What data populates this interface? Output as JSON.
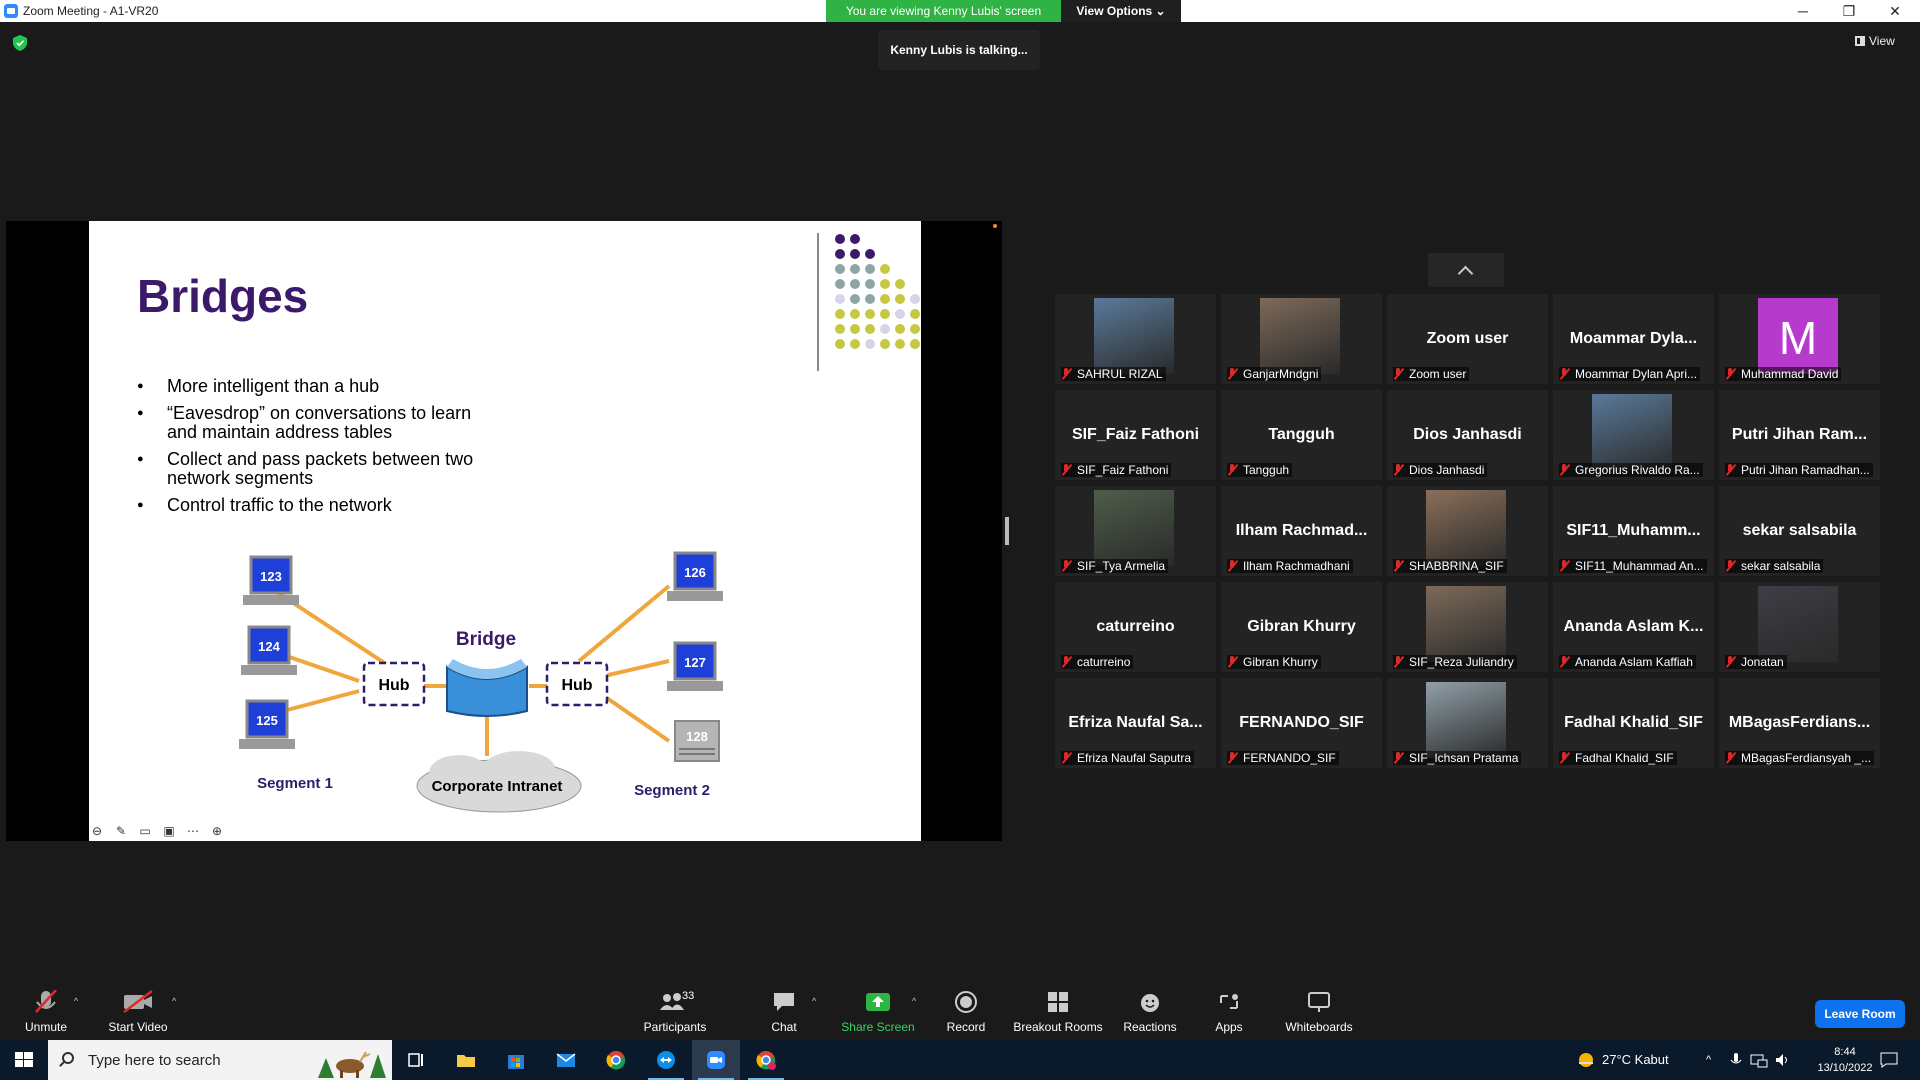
{
  "window": {
    "title": "Zoom Meeting - A1-VR20",
    "minimize": "─",
    "maximize": "❐",
    "close": "✕"
  },
  "banner": {
    "viewing": "You are viewing Kenny Lubis' screen",
    "view_options": "View Options ⌄",
    "talking": "Kenny Lubis is talking..."
  },
  "view_button": "View",
  "slide": {
    "title": "Bridges",
    "bullets": [
      "More intelligent than a hub",
      "“Eavesdrop” on conversations to learn and maintain address tables",
      "Collect and pass packets between two network segments",
      "Control traffic to the network"
    ],
    "diagram": {
      "bridge_label": "Bridge",
      "hub_left": "Hub",
      "hub_right": "Hub",
      "computers_left": [
        "123",
        "124",
        "125"
      ],
      "computers_right": [
        "126",
        "127",
        "128"
      ],
      "segment1": "Segment 1",
      "segment2": "Segment 2",
      "cloud": "Corporate Intranet"
    }
  },
  "participants": [
    {
      "name": "",
      "label": "SAHRUL RIZAL",
      "photo": true
    },
    {
      "name": "",
      "label": "GanjarMndgni",
      "photo": true
    },
    {
      "name": "Zoom user",
      "label": "Zoom user"
    },
    {
      "name": "Moammar  Dyla...",
      "label": "Moammar Dylan Apri..."
    },
    {
      "name": "",
      "label": "Muhammad David",
      "avatar": "M"
    },
    {
      "name": "SIF_Faiz Fathoni",
      "label": "SIF_Faiz Fathoni"
    },
    {
      "name": "Tangguh",
      "label": "Tangguh"
    },
    {
      "name": "Dios Janhasdi",
      "label": "Dios Janhasdi"
    },
    {
      "name": "",
      "label": "Gregorius Rivaldo Ra...",
      "photo": true
    },
    {
      "name": "Putri Jihan Ram...",
      "label": "Putri Jihan Ramadhan..."
    },
    {
      "name": "",
      "label": "SIF_Tya Armelia",
      "photo": true
    },
    {
      "name": "Ilham  Rachmad...",
      "label": "Ilham Rachmadhani"
    },
    {
      "name": "",
      "label": "SHABBRINA_SIF",
      "photo": true
    },
    {
      "name": "SIF11_Muhamm...",
      "label": "SIF11_Muhammad An..."
    },
    {
      "name": "sekar salsabila",
      "label": "sekar salsabila"
    },
    {
      "name": "caturreino",
      "label": "caturreino"
    },
    {
      "name": "Gibran Khurry",
      "label": "Gibran Khurry"
    },
    {
      "name": "",
      "label": "SIF_Reza Juliandry",
      "photo": true
    },
    {
      "name": "Ananda Aslam K...",
      "label": "Ananda Aslam Kaffiah"
    },
    {
      "name": "",
      "label": "Jonatan",
      "photo": true
    },
    {
      "name": "Efriza Naufal Sa...",
      "label": "Efriza Naufal Saputra"
    },
    {
      "name": "FERNANDO_SIF",
      "label": "FERNANDO_SIF"
    },
    {
      "name": "",
      "label": "SIF_Ichsan Pratama",
      "photo": true
    },
    {
      "name": "Fadhal Khalid_SIF",
      "label": "Fadhal Khalid_SIF"
    },
    {
      "name": "MBagasFerdians...",
      "label": "MBagasFerdiansyah _..."
    }
  ],
  "toolbar": {
    "unmute": "Unmute",
    "start_video": "Start Video",
    "participants": "Participants",
    "participants_count": "33",
    "chat": "Chat",
    "share_screen": "Share Screen",
    "record": "Record",
    "breakout": "Breakout Rooms",
    "reactions": "Reactions",
    "apps": "Apps",
    "whiteboards": "Whiteboards",
    "leave": "Leave Room"
  },
  "taskbar": {
    "search_placeholder": "Type here to search",
    "weather": "27°C  Kabut",
    "time": "8:44",
    "date": "13/10/2022"
  },
  "colors": {
    "accent": "#0e72ed",
    "share_green": "#2fb344",
    "mute_red": "#e02828",
    "slide_title": "#3b1a6b"
  }
}
